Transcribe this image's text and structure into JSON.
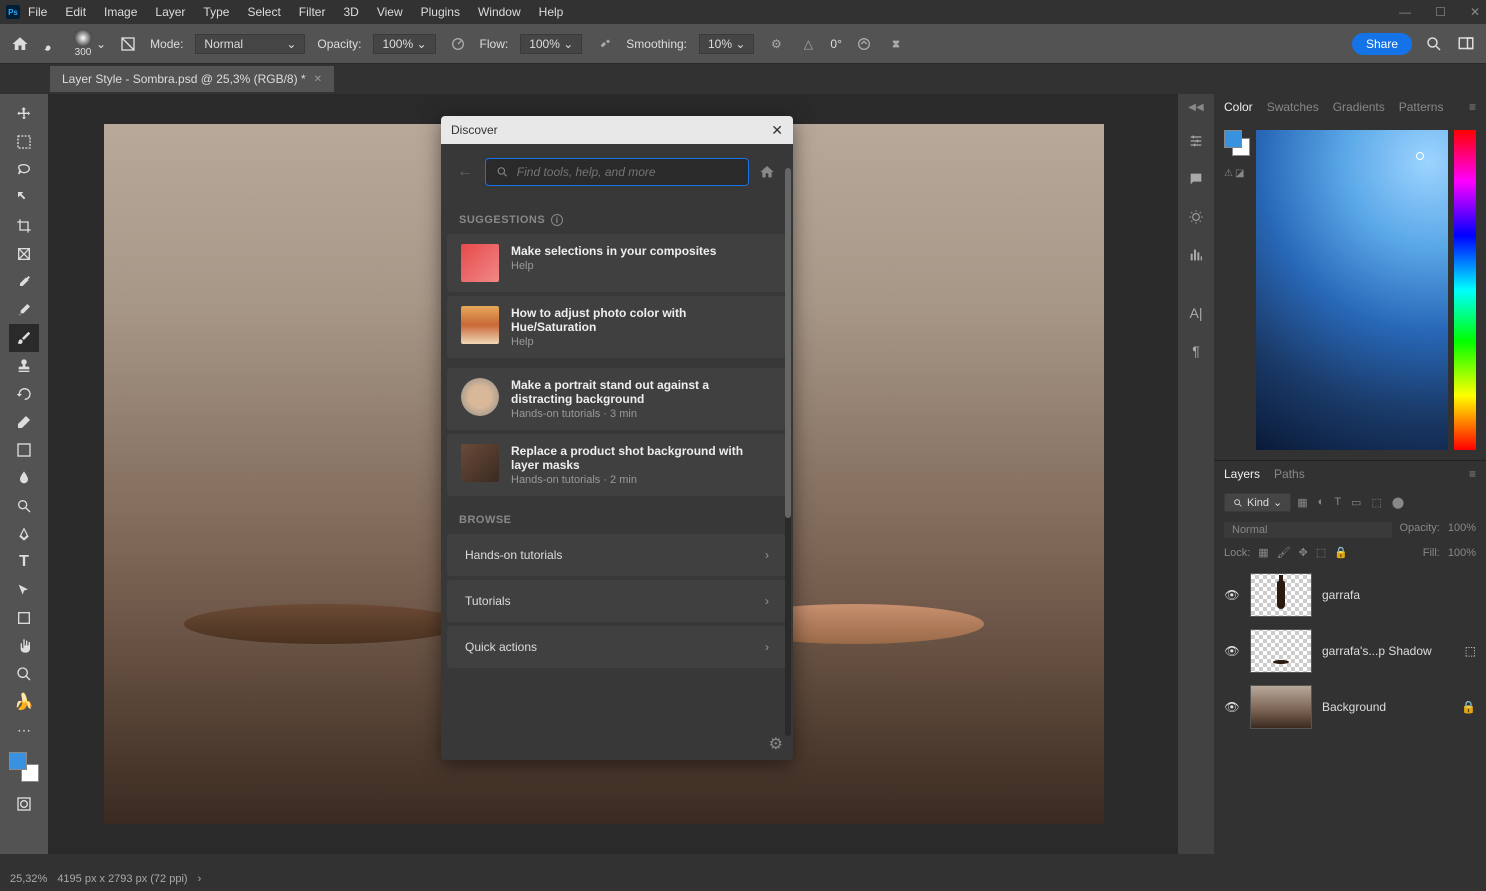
{
  "app": {
    "name": "Ps"
  },
  "menu": [
    "File",
    "Edit",
    "Image",
    "Layer",
    "Type",
    "Select",
    "Filter",
    "3D",
    "View",
    "Plugins",
    "Window",
    "Help"
  ],
  "options_bar": {
    "brush_size": "300",
    "mode_label": "Mode:",
    "mode_value": "Normal",
    "opacity_label": "Opacity:",
    "opacity_value": "100%",
    "flow_label": "Flow:",
    "flow_value": "100%",
    "smoothing_label": "Smoothing:",
    "smoothing_value": "10%",
    "angle": "0°",
    "share": "Share"
  },
  "doc_tab": {
    "title": "Layer Style - Sombra.psd @ 25,3% (RGB/8) *"
  },
  "panels": {
    "color_tabs": [
      "Color",
      "Swatches",
      "Gradients",
      "Patterns"
    ],
    "layers_tabs": [
      "Layers",
      "Paths"
    ],
    "layers_filter_kind": "Kind",
    "blend_mode": "Normal",
    "opacity_label": "Opacity:",
    "opacity_value": "100%",
    "lock_label": "Lock:",
    "fill_label": "Fill:",
    "fill_value": "100%"
  },
  "layers": [
    {
      "name": "garrafa"
    },
    {
      "name": "garrafa's...p Shadow"
    },
    {
      "name": "Background"
    }
  ],
  "discover": {
    "title": "Discover",
    "search_placeholder": "Find tools, help, and more",
    "suggestions_label": "SUGGESTIONS",
    "browse_label": "BROWSE",
    "suggestions": [
      {
        "title": "Make selections in your composites",
        "sub": "Help"
      },
      {
        "title": "How to adjust photo color with Hue/Saturation",
        "sub": "Help"
      },
      {
        "title": "Make a portrait stand out against a distracting background",
        "sub": "Hands-on tutorials  ·  3 min"
      },
      {
        "title": "Replace a product shot background with layer masks",
        "sub": "Hands-on tutorials  ·  2 min"
      }
    ],
    "browse": [
      "Hands-on tutorials",
      "Tutorials",
      "Quick actions"
    ]
  },
  "status": {
    "zoom": "25,32%",
    "dims": "4195 px x 2793 px (72 ppi)"
  }
}
